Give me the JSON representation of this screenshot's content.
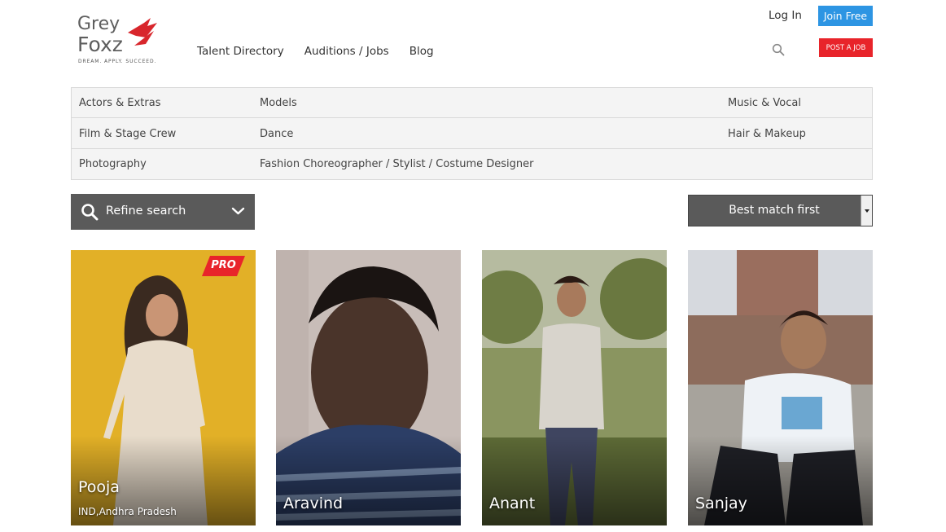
{
  "brand": {
    "logo_text_1": "Grey",
    "logo_text_2": "Foxz",
    "tagline": "DREAM. APPLY. SUCCEED."
  },
  "nav": {
    "items": [
      "Talent Directory",
      "Auditions / Jobs",
      "Blog"
    ]
  },
  "account": {
    "login": "Log In",
    "join": "Join Free",
    "post_job": "POST A JOB"
  },
  "categories": [
    [
      "Actors & Extras",
      "Models",
      "Music & Vocal"
    ],
    [
      "Film & Stage Crew",
      "Dance",
      "Hair & Makeup"
    ],
    [
      "Photography",
      "Fashion Choreographer / Stylist / Costume Designer",
      ""
    ]
  ],
  "filters": {
    "refine_label": "Refine search",
    "sort_selected": "Best match first"
  },
  "profiles": [
    {
      "name": "Pooja",
      "location": "IND,Andhra Pradesh",
      "badge": "PRO"
    },
    {
      "name": "Aravind"
    },
    {
      "name": "Anant"
    },
    {
      "name": "Sanjay"
    }
  ],
  "colors": {
    "join_blue": "#2d95e3",
    "post_red": "#e8242a",
    "dark_gray": "#5a5a5a"
  }
}
